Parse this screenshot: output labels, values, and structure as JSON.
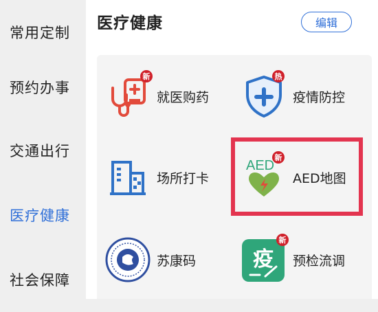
{
  "sidebar": {
    "items": [
      {
        "label": "常用定制",
        "active": false
      },
      {
        "label": "预约办事",
        "active": false
      },
      {
        "label": "交通出行",
        "active": false
      },
      {
        "label": "医疗健康",
        "active": true
      },
      {
        "label": "社会保障",
        "active": false
      }
    ]
  },
  "main": {
    "title": "医疗健康",
    "edit_label": "编辑",
    "services": [
      {
        "label": "就医购药",
        "icon": "stethoscope-clipboard-icon",
        "badge": "新"
      },
      {
        "label": "疫情防控",
        "icon": "shield-cross-icon",
        "badge": "热"
      },
      {
        "label": "场所打卡",
        "icon": "building-qr-icon",
        "badge": ""
      },
      {
        "label": "AED地图",
        "icon": "aed-heart-icon",
        "badge": "新",
        "icon_text": "AED"
      },
      {
        "label": "苏康码",
        "icon": "emblem-seal-icon",
        "badge": ""
      },
      {
        "label": "预检流调",
        "icon": "epidemic-card-icon",
        "badge": "新",
        "icon_text": "疫"
      }
    ]
  },
  "colors": {
    "accent": "#2f6fd8",
    "badge": "#d0202a",
    "highlight": "#e3344f",
    "green": "#2fa67a"
  }
}
